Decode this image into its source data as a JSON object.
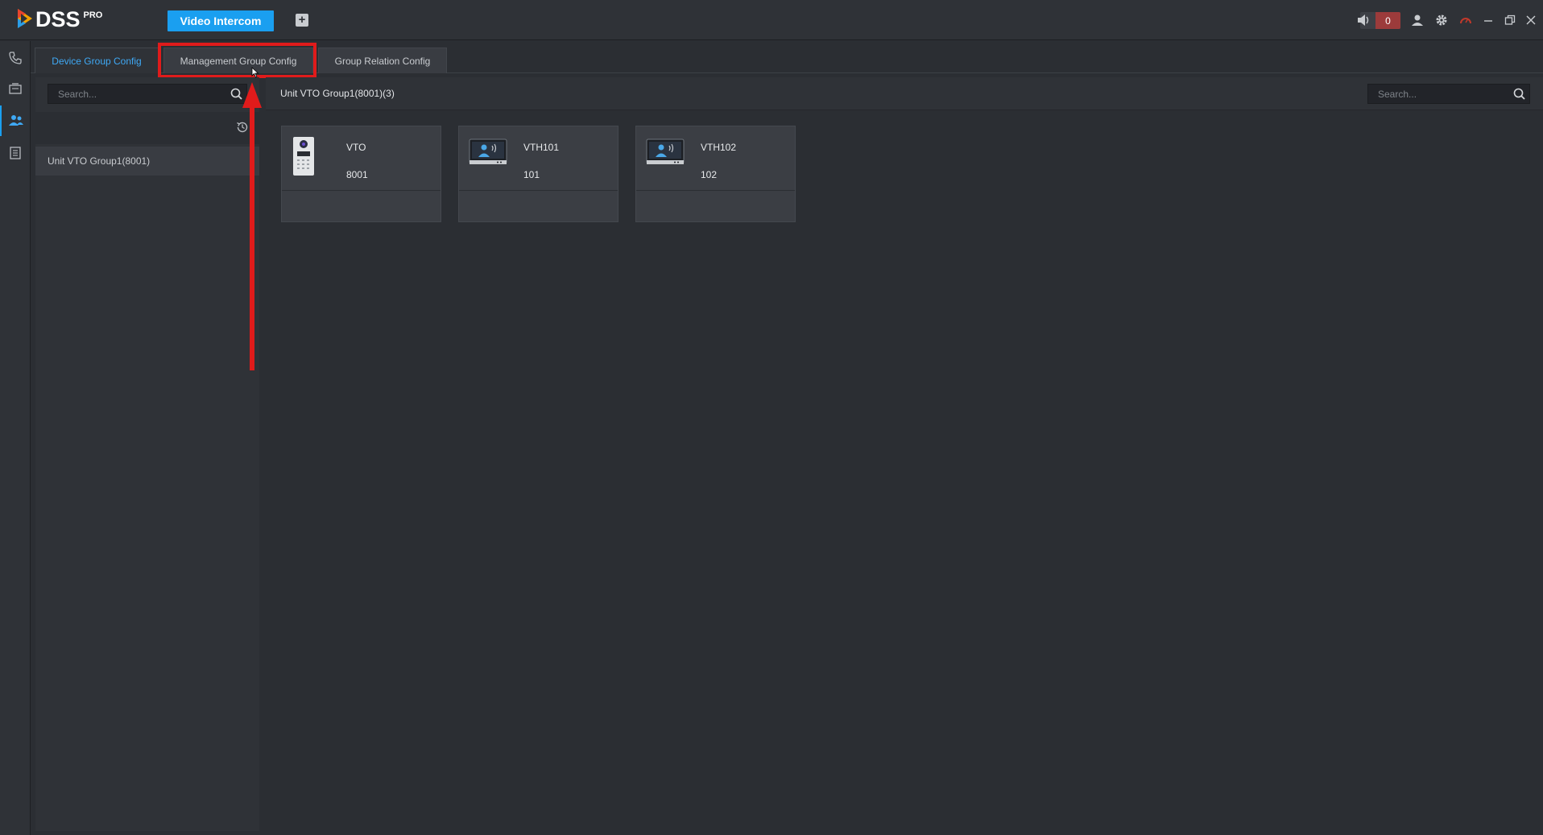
{
  "app": {
    "logo_text": "DSS",
    "logo_sup": "PRO",
    "active_module": "Video Intercom",
    "add_tab_glyph": "+",
    "alarm_count": "0"
  },
  "titlebar_icons": [
    "speaker-icon",
    "user-icon",
    "gear-icon",
    "performance-icon",
    "minimize-icon",
    "restore-icon",
    "close-icon"
  ],
  "rail": {
    "items": [
      "phone-icon",
      "device-list-icon",
      "contacts-icon",
      "record-icon"
    ],
    "active_index": 2
  },
  "subtabs": [
    {
      "label": "Device Group Config",
      "active": true
    },
    {
      "label": "Management Group Config",
      "active": false,
      "highlighted": true
    },
    {
      "label": "Group Relation Config",
      "active": false
    }
  ],
  "left_panel": {
    "search_placeholder": "Search...",
    "tree_items": [
      "Unit VTO Group1(8001)"
    ]
  },
  "main": {
    "title": "Unit VTO Group1(8001)(3)",
    "search_placeholder": "Search...",
    "devices": [
      {
        "type": "vto",
        "name": "VTO",
        "number": "8001"
      },
      {
        "type": "vth",
        "name": "VTH101",
        "number": "101"
      },
      {
        "type": "vth",
        "name": "VTH102",
        "number": "102"
      }
    ]
  },
  "colors": {
    "accent": "#1a9ff0",
    "active_tab_text": "#3fa9f5",
    "highlight": "#e01b1b",
    "alarm": "#9c3b3b"
  }
}
